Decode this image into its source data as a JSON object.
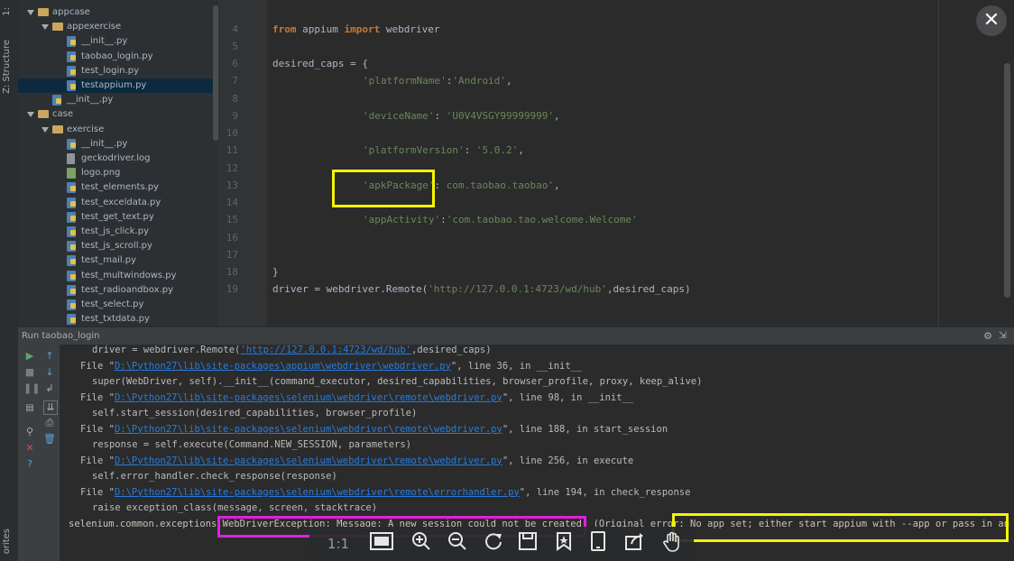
{
  "left_strip": {
    "structure_label": "Z: Structure",
    "favorites_label": "orites",
    "project_label": "1:"
  },
  "project_tree": [
    {
      "label": "appcase",
      "type": "folder",
      "level": 1,
      "expanded": true
    },
    {
      "label": "appexercise",
      "type": "folder",
      "level": 2,
      "expanded": true
    },
    {
      "label": "__init__.py",
      "type": "py",
      "level": 3
    },
    {
      "label": "taobao_login.py",
      "type": "py",
      "level": 3
    },
    {
      "label": "test_login.py",
      "type": "py",
      "level": 3
    },
    {
      "label": "testappium.py",
      "type": "py",
      "level": 3,
      "selected": true
    },
    {
      "label": "__init__.py",
      "type": "py",
      "level": 2
    },
    {
      "label": "case",
      "type": "folder",
      "level": 1,
      "expanded": true
    },
    {
      "label": "exercise",
      "type": "folder",
      "level": 2,
      "expanded": true
    },
    {
      "label": "__init__.py",
      "type": "py",
      "level": 3
    },
    {
      "label": "geckodriver.log",
      "type": "log",
      "level": 3
    },
    {
      "label": "logo.png",
      "type": "png",
      "level": 3
    },
    {
      "label": "test_elements.py",
      "type": "py",
      "level": 3
    },
    {
      "label": "test_exceldata.py",
      "type": "py",
      "level": 3
    },
    {
      "label": "test_get_text.py",
      "type": "py",
      "level": 3
    },
    {
      "label": "test_js_click.py",
      "type": "py",
      "level": 3
    },
    {
      "label": "test_js_scroll.py",
      "type": "py",
      "level": 3
    },
    {
      "label": "test_mail.py",
      "type": "py",
      "level": 3
    },
    {
      "label": "test_multwindows.py",
      "type": "py",
      "level": 3
    },
    {
      "label": "test_radioandbox.py",
      "type": "py",
      "level": 3
    },
    {
      "label": "test_select.py",
      "type": "py",
      "level": 3
    },
    {
      "label": "test_txtdata.py",
      "type": "py",
      "level": 3
    }
  ],
  "editor": {
    "lines": [
      {
        "num": "4",
        "k1": "from",
        "t1": " appium ",
        "k2": "import",
        "t2": " webdriver"
      },
      {
        "num": "5"
      },
      {
        "num": "6",
        "text": "desired_caps = {"
      },
      {
        "num": "7",
        "s1": "'platformName'",
        "t1": ":",
        "s2": "'Android'",
        "t2": ","
      },
      {
        "num": "8"
      },
      {
        "num": "9",
        "s1": "'deviceName'",
        "t1": ": ",
        "s2": "'U0V4VSGY99999999'",
        "t2": ","
      },
      {
        "num": "10"
      },
      {
        "num": "11",
        "s1": "'platformVersion'",
        "t1": ": ",
        "s2": "'5.0.2'",
        "t2": ","
      },
      {
        "num": "12"
      },
      {
        "num": "13",
        "s1": "'apkPackage'",
        "t1": ": ",
        "s2": "com.taobao.taobao'",
        "t2": ","
      },
      {
        "num": "14"
      },
      {
        "num": "15",
        "s1": "'appActivity'",
        "t1": ":",
        "s2": "'com.taobao.tao.welcome.Welcome'",
        "t2": ""
      },
      {
        "num": "16"
      },
      {
        "num": "17"
      },
      {
        "num": "18",
        "text": "}"
      },
      {
        "num": "19",
        "t1": "driver = webdriver.Remote(",
        "s1": "'http://127.0.0.1:4723/wd/hub'",
        "t2": ",desired_caps)"
      }
    ]
  },
  "run": {
    "title": "Run",
    "config": "taobao_login"
  },
  "console": {
    "lines": [
      {
        "indent": 2,
        "a": "driver = webdriver.Remote(",
        "link": "'http://127.0.0.1:4723/wd/hub'",
        "b": ",desired_caps)"
      },
      {
        "indent": 1,
        "a": "File \"",
        "link": "D:\\Python27\\lib\\site-packages\\appium\\webdriver\\webdriver.py",
        "b": "\", line 36, in __init__"
      },
      {
        "indent": 2,
        "a": "super(WebDriver, self).__init__(command_executor, desired_capabilities, browser_profile, proxy, keep_alive)"
      },
      {
        "indent": 1,
        "a": "File \"",
        "link": "D:\\Python27\\lib\\site-packages\\selenium\\webdriver\\remote\\webdriver.py",
        "b": "\", line 98, in __init__"
      },
      {
        "indent": 2,
        "a": "self.start_session(desired_capabilities, browser_profile)"
      },
      {
        "indent": 1,
        "a": "File \"",
        "link": "D:\\Python27\\lib\\site-packages\\selenium\\webdriver\\remote\\webdriver.py",
        "b": "\", line 188, in start_session"
      },
      {
        "indent": 2,
        "a": "response = self.execute(Command.NEW_SESSION, parameters)"
      },
      {
        "indent": 1,
        "a": "File \"",
        "link": "D:\\Python27\\lib\\site-packages\\selenium\\webdriver\\remote\\webdriver.py",
        "b": "\", line 256, in execute"
      },
      {
        "indent": 2,
        "a": "self.error_handler.check_response(response)"
      },
      {
        "indent": 1,
        "a": "File \"",
        "link": "D:\\Python27\\lib\\site-packages\\selenium\\webdriver\\remote\\errorhandler.py",
        "b": "\", line 194, in check_response"
      },
      {
        "indent": 2,
        "a": "raise exception_class(message, screen, stacktrace)"
      },
      {
        "indent": 0,
        "a": "selenium.common.exceptions.WebDriverException: Message: A new session could not be created. (Original error: No app set; either start appium with --app or pass in an 'ap"
      }
    ]
  },
  "viewer": {
    "close_label": "✕",
    "zoom_ratio": "1:1",
    "tools": [
      "fit-screen-icon",
      "zoom-in-icon",
      "zoom-out-icon",
      "rotate-icon",
      "save-icon",
      "bookmark-icon",
      "tablet-icon",
      "share-icon",
      "hand-icon"
    ]
  },
  "colors": {
    "highlight_yellow": "#f4f400",
    "highlight_magenta": "#e020e0",
    "link": "#287bde"
  }
}
